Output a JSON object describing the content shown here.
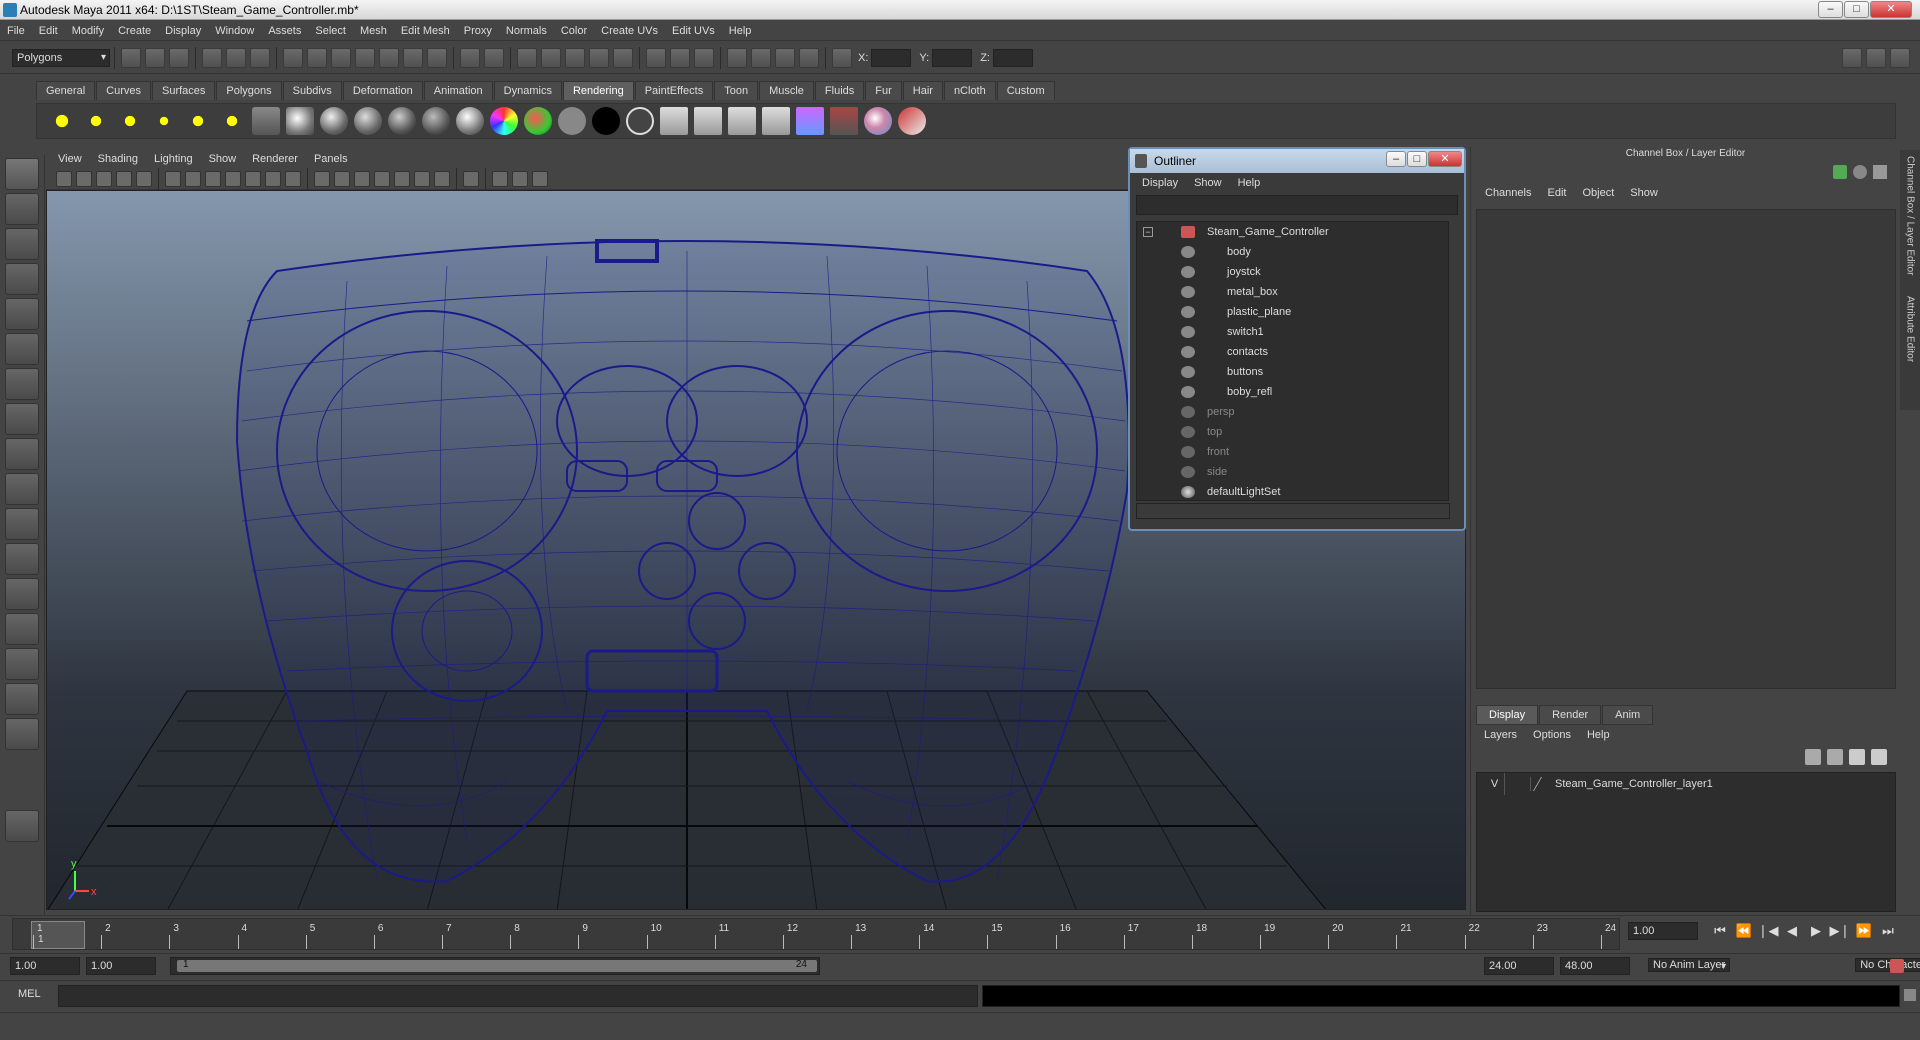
{
  "window": {
    "title": "Autodesk Maya 2011 x64: D:\\1ST\\Steam_Game_Controller.mb*"
  },
  "menu": [
    "File",
    "Edit",
    "Modify",
    "Create",
    "Display",
    "Window",
    "Assets",
    "Select",
    "Mesh",
    "Edit Mesh",
    "Proxy",
    "Normals",
    "Color",
    "Create UVs",
    "Edit UVs",
    "Help"
  ],
  "status": {
    "mode": "Polygons",
    "x_label": "X:",
    "y_label": "Y:",
    "z_label": "Z:"
  },
  "shelf_tabs": [
    "General",
    "Curves",
    "Surfaces",
    "Polygons",
    "Subdivs",
    "Deformation",
    "Animation",
    "Dynamics",
    "Rendering",
    "PaintEffects",
    "Toon",
    "Muscle",
    "Fluids",
    "Fur",
    "Hair",
    "nCloth",
    "Custom"
  ],
  "active_shelf_tab": "Rendering",
  "viewport_menu": [
    "View",
    "Shading",
    "Lighting",
    "Show",
    "Renderer",
    "Panels"
  ],
  "axis": {
    "y": "y",
    "x": "x"
  },
  "outliner": {
    "title": "Outliner",
    "menu": [
      "Display",
      "Show",
      "Help"
    ],
    "root": "Steam_Game_Controller",
    "children": [
      "body",
      "joystck",
      "metal_box",
      "plastic_plane",
      "switch1",
      "contacts",
      "buttons",
      "boby_refl"
    ],
    "cameras": [
      "persp",
      "top",
      "front",
      "side"
    ],
    "sets": [
      "defaultLightSet"
    ]
  },
  "channel_box": {
    "header": "Channel Box / Layer Editor",
    "menu": [
      "Channels",
      "Edit",
      "Object",
      "Show"
    ],
    "layer_tabs": [
      "Display",
      "Render",
      "Anim"
    ],
    "active_layer_tab": "Display",
    "layer_menu": [
      "Layers",
      "Options",
      "Help"
    ],
    "layers": [
      {
        "visible": "V",
        "name": "Steam_Game_Controller_layer1"
      }
    ]
  },
  "side_tabs": [
    "Channel Box / Layer Editor",
    "Attribute Editor"
  ],
  "timeline": {
    "ticks": [
      "1",
      "2",
      "3",
      "4",
      "5",
      "6",
      "7",
      "8",
      "9",
      "10",
      "11",
      "12",
      "13",
      "14",
      "15",
      "16",
      "17",
      "18",
      "19",
      "20",
      "21",
      "22",
      "23",
      "24"
    ],
    "current": "1",
    "current_time": "1.00"
  },
  "range": {
    "start": "1.00",
    "start2": "1.00",
    "handle_start": "1",
    "handle_end": "24",
    "end": "24.00",
    "end2": "48.00",
    "anim_layer": "No Anim Layer",
    "char_set": "No Character Set"
  },
  "cmdline": {
    "label": "MEL"
  }
}
